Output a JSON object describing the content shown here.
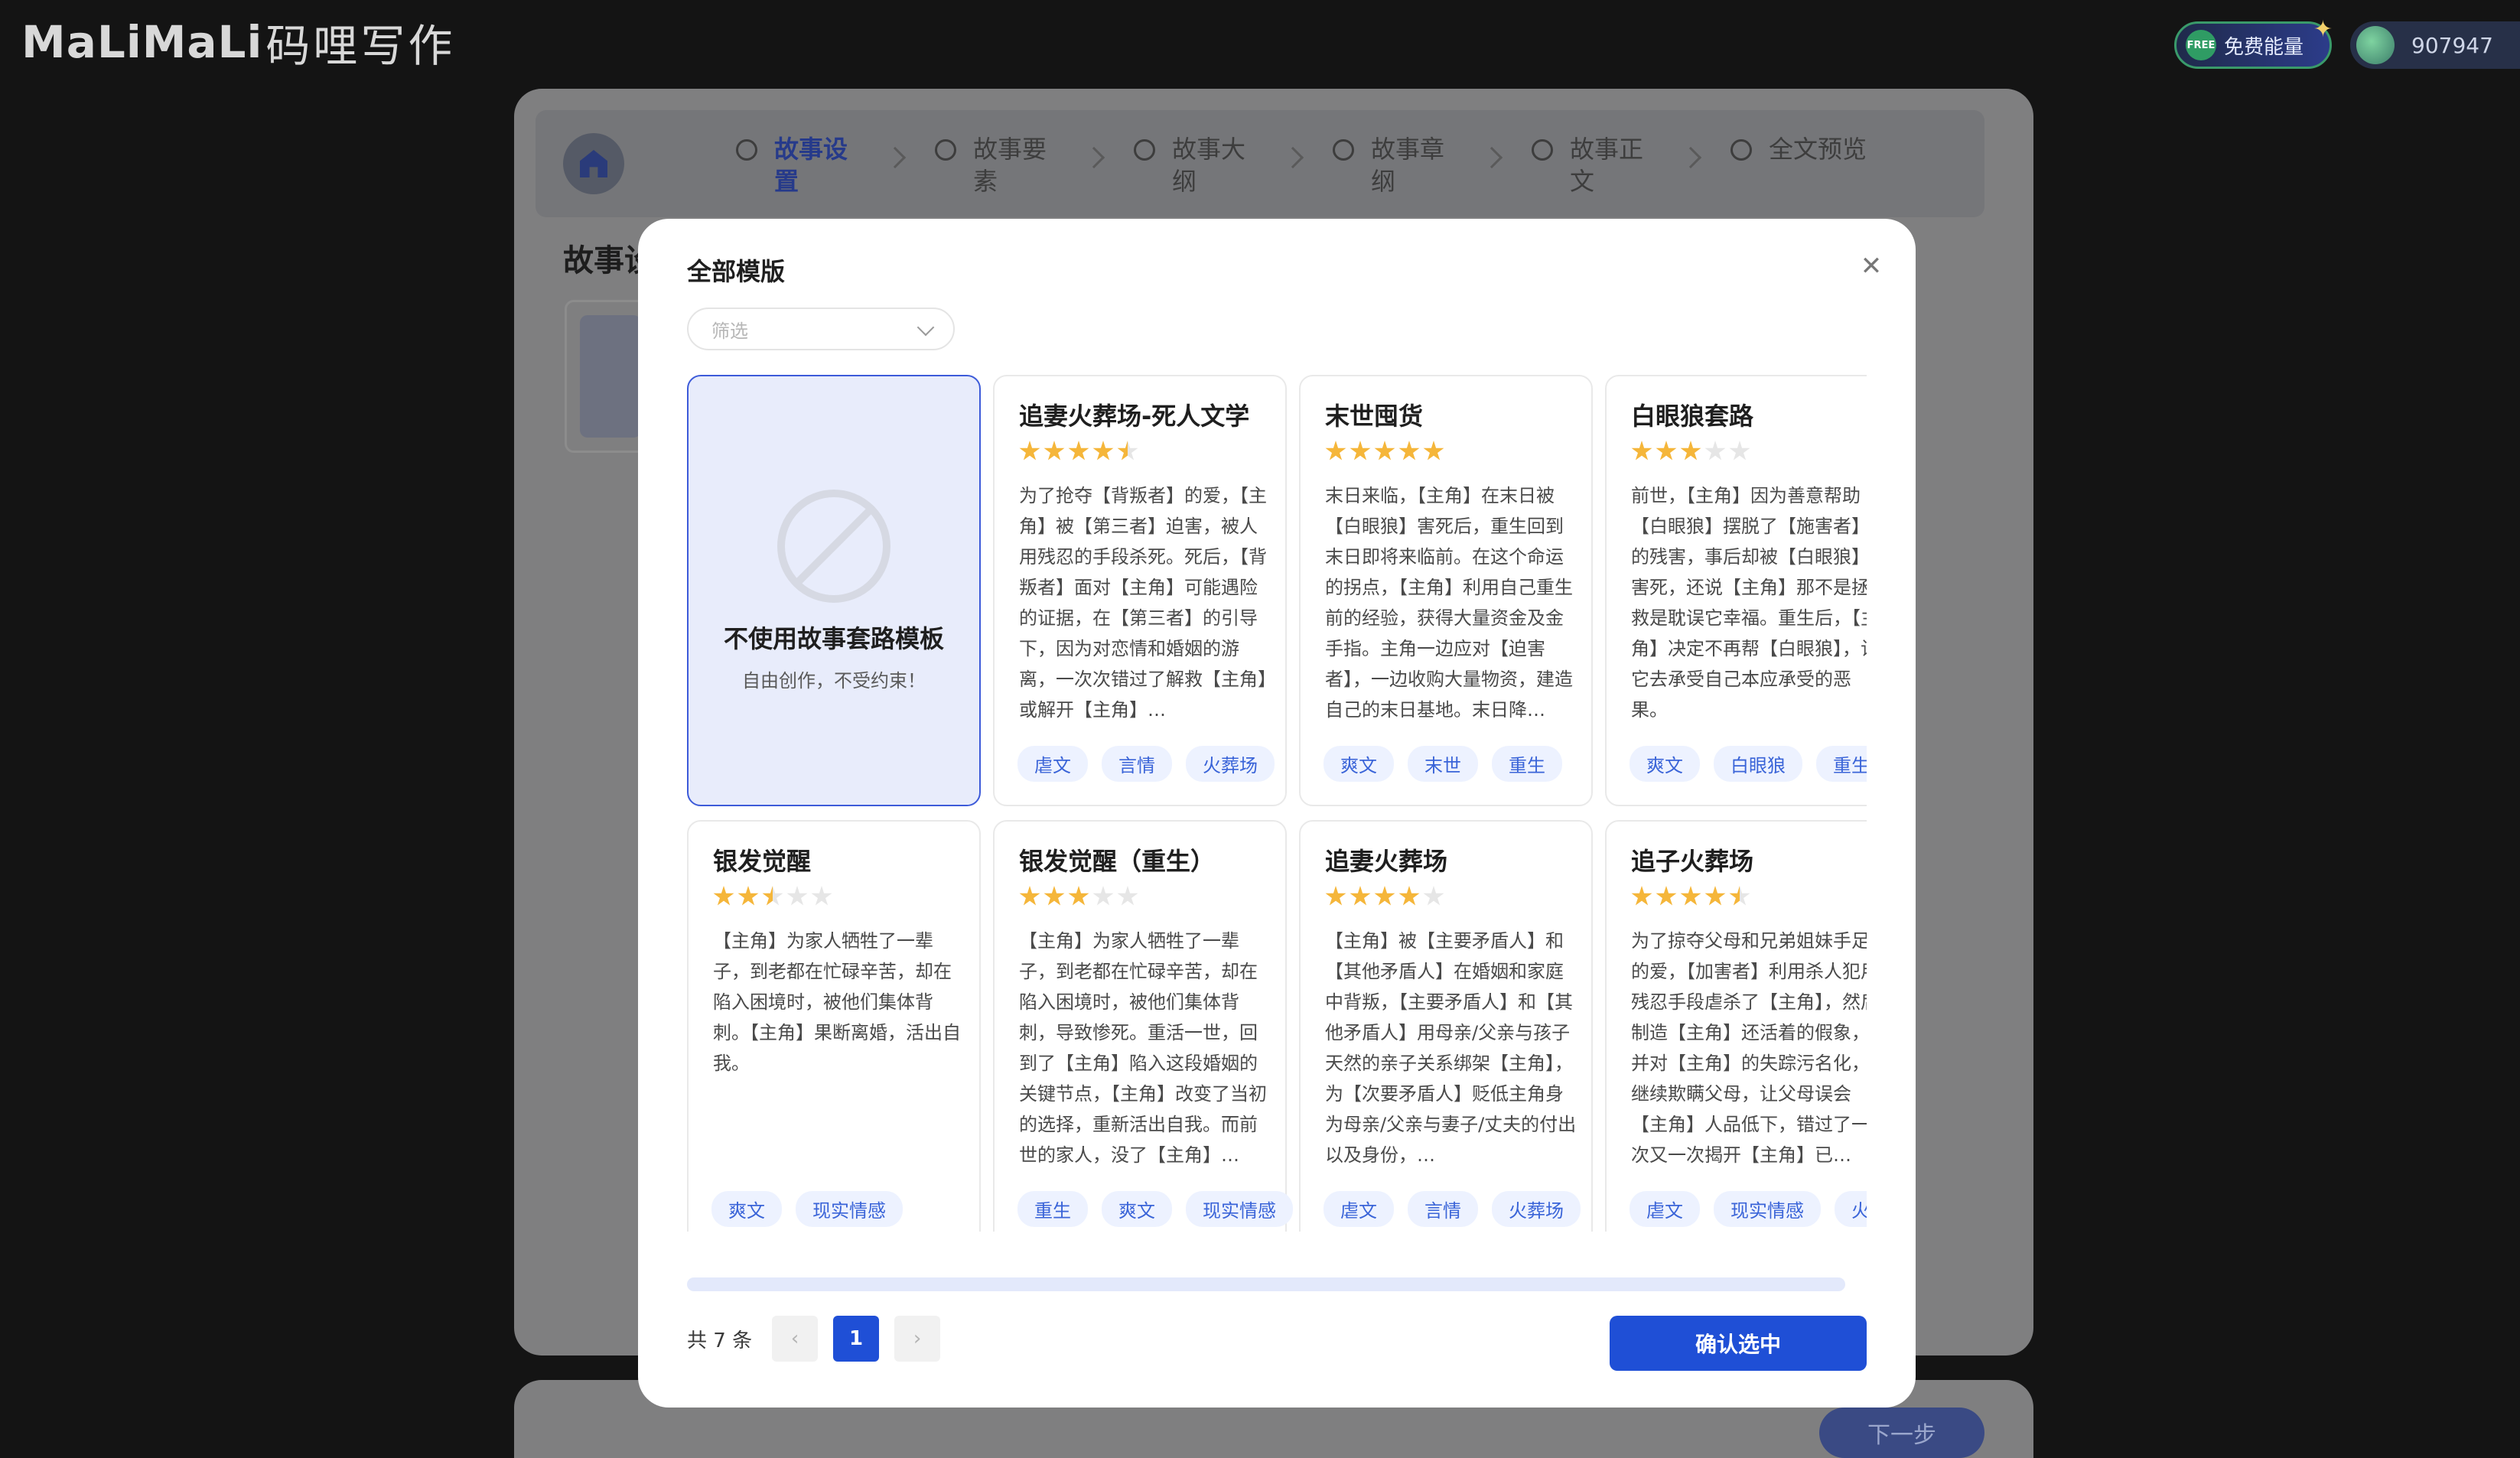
{
  "topbar": {
    "logo_latin": "MaLiMaLi",
    "logo_cn": "码哩写作",
    "free_badge": "FREE",
    "free_label": "免费能量",
    "energy_count": "907947"
  },
  "steps": [
    {
      "label": "故事设置",
      "active": true
    },
    {
      "label": "故事要素",
      "active": false
    },
    {
      "label": "故事大纲",
      "active": false
    },
    {
      "label": "故事章纲",
      "active": false
    },
    {
      "label": "故事正文",
      "active": false
    },
    {
      "label": "全文预览",
      "active": false
    }
  ],
  "background": {
    "section_title": "故事设",
    "next_button": "下一步"
  },
  "modal": {
    "title": "全部模版",
    "filter_placeholder": "筛选",
    "none_card": {
      "title": "不使用故事套路模板",
      "subtitle": "自由创作，不受约束！"
    },
    "templates": [
      {
        "title": "追妻火葬场-死人文学",
        "rating": 4.5,
        "desc": "为了抢夺【背叛者】的爱，【主角】被【第三者】迫害，被人用残忍的手段杀死。死后，【背叛者】面对【主角】可能遇险的证据，在【第三者】的引导下，因为对恋情和婚姻的游离，一次次错过了解救【主角】或解开【主角】…",
        "tags": [
          "虐文",
          "言情",
          "火葬场"
        ]
      },
      {
        "title": "末世囤货",
        "rating": 5,
        "desc": "末日来临，【主角】在末日被【白眼狼】害死后，重生回到末日即将来临前。在这个命运的拐点，【主角】利用自己重生前的经验，获得大量资金及金手指。主角一边应对【迫害者】，一边收购大量物资，建造自己的末日基地。末日降…",
        "tags": [
          "爽文",
          "末世",
          "重生"
        ]
      },
      {
        "title": "白眼狼套路",
        "rating": 3,
        "desc": "前世，【主角】因为善意帮助【白眼狼】摆脱了【施害者】的残害，事后却被【白眼狼】害死，还说【主角】那不是拯救是耽误它幸福。重生后，【主角】决定不再帮【白眼狼】，让它去承受自己本应承受的恶果。",
        "tags": [
          "爽文",
          "白眼狼",
          "重生"
        ]
      },
      {
        "title": "银发觉醒",
        "rating": 2.5,
        "desc": "【主角】为家人牺牲了一辈子，到老都在忙碌辛苦，却在陷入困境时，被他们集体背刺。【主角】果断离婚，活出自我。",
        "tags": [
          "爽文",
          "现实情感"
        ]
      },
      {
        "title": "银发觉醒（重生）",
        "rating": 3,
        "desc": "【主角】为家人牺牲了一辈子，到老都在忙碌辛苦，却在陷入困境时，被他们集体背刺，导致惨死。重活一世，回到了【主角】陷入这段婚姻的关键节点，【主角】改变了当初的选择，重新活出自我。而前世的家人，没了【主角】…",
        "tags": [
          "重生",
          "爽文",
          "现实情感"
        ]
      },
      {
        "title": "追妻火葬场",
        "rating": 4,
        "desc": "【主角】被【主要矛盾人】和【其他矛盾人】在婚姻和家庭中背叛，【主要矛盾人】和【其他矛盾人】用母亲/父亲与孩子天然的亲子关系绑架【主角】，为【次要矛盾人】贬低主角身为母亲/父亲与妻子/丈夫的付出以及身份，…",
        "tags": [
          "虐文",
          "言情",
          "火葬场"
        ]
      },
      {
        "title": "追子火葬场",
        "rating": 4.5,
        "desc": "为了掠夺父母和兄弟姐妹手足的爱，【加害者】利用杀人犯用残忍手段虐杀了【主角】，然后制造【主角】还活着的假象，并对【主角】的失踪污名化，继续欺瞒父母，让父母误会【主角】人品低下，错过了一次又一次揭开【主角】已…",
        "tags": [
          "虐文",
          "现实情感",
          "火葬场"
        ]
      }
    ],
    "total_text": "共 7 条",
    "current_page": "1",
    "prev_icon": "‹",
    "next_icon": "›",
    "confirm_button": "确认选中"
  }
}
